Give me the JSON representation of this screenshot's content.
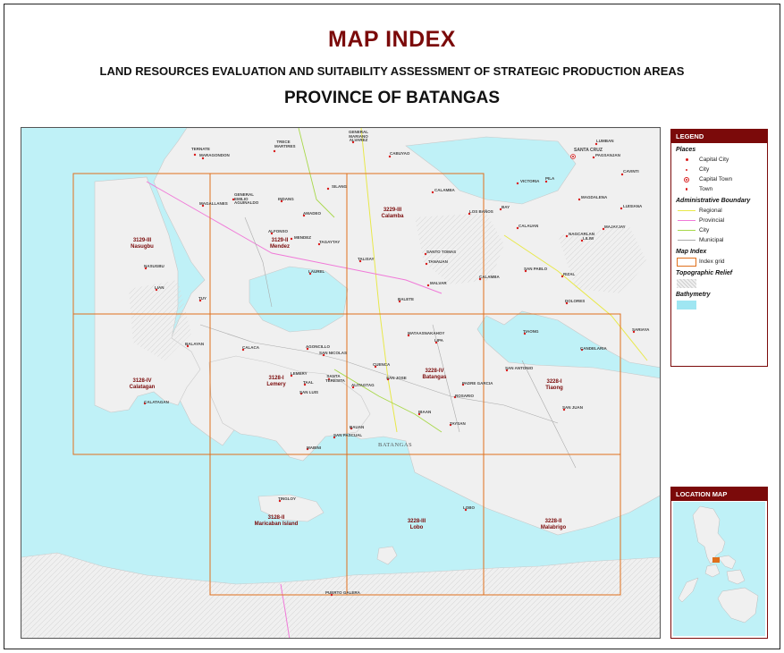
{
  "header": {
    "title": "MAP INDEX",
    "subtitle": "LAND RESOURCES EVALUATION AND SUITABILITY ASSESSMENT OF STRATEGIC PRODUCTION AREAS",
    "province": "PROVINCE OF BATANGAS"
  },
  "colors": {
    "title": "#7b0a0a",
    "grid": "#e0701c",
    "sea": "#bff1f7",
    "land": "#f0f0f0",
    "regional": "#e8e84a",
    "provincial": "#f07ad8",
    "city": "#a8d84a",
    "municipal": "#aaaaaa",
    "place_marker": "#d81b1b"
  },
  "grid_cells": [
    {
      "code": "3129-III",
      "name": "Nasugbu"
    },
    {
      "code": "3129-II",
      "name": "Mendez"
    },
    {
      "code": "3229-III",
      "name": "Calamba"
    },
    {
      "code": "3128-IV",
      "name": "Calatagan"
    },
    {
      "code": "3128-I",
      "name": "Lemery"
    },
    {
      "code": "3228-IV",
      "name": "Batangas"
    },
    {
      "code": "3228-I",
      "name": "Tiaong"
    },
    {
      "code": "3128-II",
      "name": "Maricaban Island"
    },
    {
      "code": "3228-III",
      "name": "Lobo"
    },
    {
      "code": "3228-II",
      "name": "Malabrigo"
    }
  ],
  "places": [
    "TERNATE",
    "MARAGONDON",
    "TRECE MARTIRES",
    "GENERAL MARIANO ALVAREZ",
    "CABUYAO",
    "SANTA CRUZ",
    "LUMBAN",
    "PAGSANJAN",
    "CAVINTI",
    "SILANG",
    "CALAMBA",
    "VICTORIA",
    "PILA",
    "MAGDALENA",
    "LUISIANA",
    "GENERAL EMILIO AGUINALDO",
    "MAGALLANES",
    "INDANG",
    "AMADEO",
    "LOS BAÑOS",
    "BAY",
    "CALAUAN",
    "NAGCARLAN",
    "LILIW",
    "MAJAYJAY",
    "ALFONSO",
    "MENDEZ",
    "TAGAYTAY",
    "SANTO TOMAS",
    "TANAUAN",
    "TALISAY",
    "SAN PABLO",
    "RIZAL",
    "NASUGBU",
    "LAUREL",
    "MALVAR",
    "CALAMBA",
    "LIAN",
    "TUY",
    "BALETE",
    "DOLORES",
    "SARIAYA",
    "MATAASNAKAHOY",
    "LIPA",
    "TIAONG",
    "BALAYAN",
    "CALACA",
    "AGONCILLO",
    "SAN NICOLAS",
    "CANDELARIA",
    "CUENCA",
    "SAN ANTONIO",
    "LEMERY",
    "SANTA TERESITA",
    "TAAL",
    "ALITAGTAG",
    "SAN JOSE",
    "PADRE GARCIA",
    "SAN LUIS",
    "ROSARIO",
    "CALATAGAN",
    "IBAAN",
    "TAYSAN",
    "SAN JUAN",
    "BAUAN",
    "SAN PASCUAL",
    "MABINI",
    "TINGLOY",
    "LOBO",
    "PUERTO GALERA"
  ],
  "batangas_city_label": "BATANGAS",
  "legend": {
    "title": "LEGEND",
    "places_heading": "Places",
    "places": [
      "Capital City",
      "City",
      "Capital Town",
      "Town"
    ],
    "admin_heading": "Administrative Boundary",
    "admin": [
      "Regional",
      "Provincial",
      "City",
      "Municipal"
    ],
    "index_heading": "Map Index",
    "index_item": "Index grid",
    "relief_heading": "Topographic Relief",
    "bathy_heading": "Bathymetry"
  },
  "location_map": {
    "title": "LOCATION MAP"
  }
}
